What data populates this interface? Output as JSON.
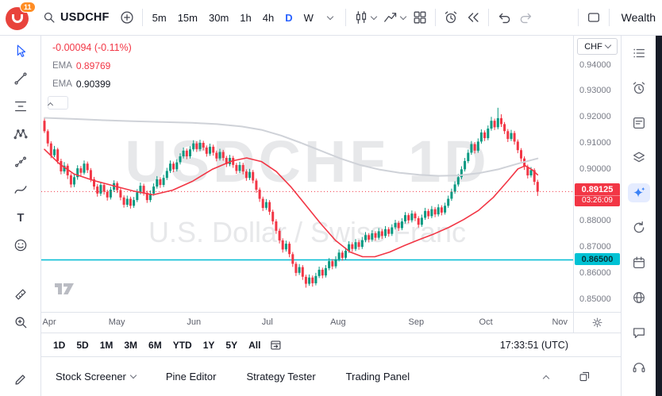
{
  "topbar": {
    "logo_badge": "11",
    "symbol": "USDCHF",
    "timeframes": [
      "5m",
      "15m",
      "30m",
      "1h",
      "4h",
      "D",
      "W"
    ],
    "active_timeframe": "D",
    "right_label": "Wealth"
  },
  "icons": {
    "text_tool_glyph": "T"
  },
  "legend": {
    "change": "-0.00094 (-0.11%)",
    "ema_fast_label": "EMA",
    "ema_fast_value": "0.89769",
    "ema_slow_label": "EMA",
    "ema_slow_value": "0.90399"
  },
  "watermark": {
    "title": "USDCHF 1D",
    "subtitle": "U.S. Dollar / Swiss Franc"
  },
  "price_axis": {
    "currency_label": "CHF",
    "tick_labels": [
      "0.94000",
      "0.93000",
      "0.92000",
      "0.91000",
      "0.90000",
      "0.88000",
      "0.87000",
      "0.86000",
      "0.85000"
    ],
    "last_price_badge": {
      "price": "0.89125",
      "countdown": "03:26:09"
    },
    "level_badge": "0.86500"
  },
  "range_toolbar": {
    "items": [
      "1D",
      "5D",
      "1M",
      "3M",
      "6M",
      "YTD",
      "1Y",
      "5Y",
      "All"
    ],
    "clock": "17:33:51 (UTC)"
  },
  "bottom_panel": {
    "tabs": [
      "Stock Screener",
      "Pine Editor",
      "Strategy Tester",
      "Trading Panel"
    ]
  },
  "chart_data": {
    "type": "candlestick",
    "symbol": "USDCHF",
    "interval": "1D",
    "ylim": [
      0.845,
      0.9512
    ],
    "levels": {
      "last": 0.89125,
      "support": 0.865
    },
    "colors": {
      "up": "#089981",
      "down": "#f23645",
      "ema_fast": "#f23645",
      "ema_slow": "#cfd2d8",
      "support": "#00bcd4"
    },
    "months": [
      {
        "label": "Apr",
        "frac": 0.015
      },
      {
        "label": "May",
        "frac": 0.142
      },
      {
        "label": "Jun",
        "frac": 0.287
      },
      {
        "label": "Jul",
        "frac": 0.425
      },
      {
        "label": "Aug",
        "frac": 0.558
      },
      {
        "label": "Sep",
        "frac": 0.705
      },
      {
        "label": "Oct",
        "frac": 0.836
      },
      {
        "label": "Nov",
        "frac": 0.975
      }
    ],
    "ema_slow_points": [
      [
        0,
        0.9196
      ],
      [
        0.06,
        0.9192
      ],
      [
        0.12,
        0.9187
      ],
      [
        0.18,
        0.9183
      ],
      [
        0.24,
        0.918
      ],
      [
        0.3,
        0.9177
      ],
      [
        0.35,
        0.9172
      ],
      [
        0.4,
        0.9163
      ],
      [
        0.44,
        0.915
      ],
      [
        0.48,
        0.9128
      ],
      [
        0.52,
        0.91
      ],
      [
        0.56,
        0.907
      ],
      [
        0.6,
        0.904
      ],
      [
        0.64,
        0.9015
      ],
      [
        0.68,
        0.8997
      ],
      [
        0.72,
        0.8985
      ],
      [
        0.76,
        0.8977
      ],
      [
        0.8,
        0.8973
      ],
      [
        0.84,
        0.8975
      ],
      [
        0.88,
        0.8983
      ],
      [
        0.92,
        0.8998
      ],
      [
        0.96,
        0.902
      ],
      [
        1,
        0.904
      ]
    ],
    "ema_fast_points": [
      [
        0,
        0.9075
      ],
      [
        0.03,
        0.902
      ],
      [
        0.06,
        0.898
      ],
      [
        0.1,
        0.8955
      ],
      [
        0.14,
        0.8935
      ],
      [
        0.18,
        0.8915
      ],
      [
        0.22,
        0.89
      ],
      [
        0.26,
        0.8918
      ],
      [
        0.3,
        0.8952
      ],
      [
        0.34,
        0.8998
      ],
      [
        0.38,
        0.903
      ],
      [
        0.41,
        0.9042
      ],
      [
        0.44,
        0.9028
      ],
      [
        0.47,
        0.899
      ],
      [
        0.5,
        0.893
      ],
      [
        0.53,
        0.886
      ],
      [
        0.56,
        0.879
      ],
      [
        0.59,
        0.8725
      ],
      [
        0.62,
        0.868
      ],
      [
        0.645,
        0.8662
      ],
      [
        0.67,
        0.8662
      ],
      [
        0.7,
        0.868
      ],
      [
        0.73,
        0.8705
      ],
      [
        0.76,
        0.8728
      ],
      [
        0.79,
        0.875
      ],
      [
        0.82,
        0.8775
      ],
      [
        0.85,
        0.8805
      ],
      [
        0.88,
        0.884
      ],
      [
        0.91,
        0.889
      ],
      [
        0.94,
        0.8955
      ],
      [
        0.96,
        0.9
      ],
      [
        0.975,
        0.9012
      ],
      [
        0.99,
        0.8995
      ],
      [
        1,
        0.8977
      ]
    ],
    "candles": [
      [
        0.9185,
        0.9193,
        0.9138,
        0.9145
      ],
      [
        0.9145,
        0.9152,
        0.9086,
        0.9098
      ],
      [
        0.9098,
        0.9106,
        0.9041,
        0.9052
      ],
      [
        0.9052,
        0.9088,
        0.9045,
        0.9075
      ],
      [
        0.9075,
        0.9081,
        0.9019,
        0.903
      ],
      [
        0.903,
        0.9039,
        0.8979,
        0.899
      ],
      [
        0.899,
        0.9026,
        0.8982,
        0.9012
      ],
      [
        0.9012,
        0.902,
        0.8961,
        0.8975
      ],
      [
        0.8975,
        0.8983,
        0.8928,
        0.894
      ],
      [
        0.894,
        0.8979,
        0.893,
        0.8968
      ],
      [
        0.8968,
        0.9014,
        0.8958,
        0.9002
      ],
      [
        0.9002,
        0.9011,
        0.8972,
        0.8985
      ],
      [
        0.8985,
        0.9032,
        0.8978,
        0.902
      ],
      [
        0.902,
        0.9028,
        0.8984,
        0.8995
      ],
      [
        0.8995,
        0.9003,
        0.8949,
        0.896
      ],
      [
        0.896,
        0.8969,
        0.892,
        0.8932
      ],
      [
        0.8932,
        0.8941,
        0.8893,
        0.8905
      ],
      [
        0.8905,
        0.895,
        0.8896,
        0.8938
      ],
      [
        0.8938,
        0.8946,
        0.8901,
        0.8912
      ],
      [
        0.8912,
        0.892,
        0.8878,
        0.889
      ],
      [
        0.889,
        0.8931,
        0.8882,
        0.892
      ],
      [
        0.892,
        0.8956,
        0.8911,
        0.8945
      ],
      [
        0.8945,
        0.8952,
        0.8907,
        0.8918
      ],
      [
        0.8918,
        0.8926,
        0.8879,
        0.889
      ],
      [
        0.889,
        0.8898,
        0.8851,
        0.8862
      ],
      [
        0.8862,
        0.8897,
        0.8853,
        0.8885
      ],
      [
        0.8885,
        0.8893,
        0.8847,
        0.8858
      ],
      [
        0.8858,
        0.8892,
        0.885,
        0.888
      ],
      [
        0.888,
        0.8922,
        0.8872,
        0.891
      ],
      [
        0.891,
        0.8947,
        0.8902,
        0.8935
      ],
      [
        0.8935,
        0.8943,
        0.8897,
        0.8908
      ],
      [
        0.8908,
        0.8916,
        0.8869,
        0.888
      ],
      [
        0.888,
        0.8917,
        0.8872,
        0.8905
      ],
      [
        0.8905,
        0.8944,
        0.8897,
        0.8932
      ],
      [
        0.8932,
        0.8972,
        0.8924,
        0.896
      ],
      [
        0.896,
        0.8968,
        0.8927,
        0.8938
      ],
      [
        0.8938,
        0.8977,
        0.893,
        0.8965
      ],
      [
        0.8965,
        0.9004,
        0.8957,
        0.8992
      ],
      [
        0.8992,
        0.9032,
        0.8984,
        0.902
      ],
      [
        0.902,
        0.9028,
        0.8987,
        0.8998
      ],
      [
        0.8998,
        0.9037,
        0.899,
        0.9025
      ],
      [
        0.9025,
        0.906,
        0.9017,
        0.9048
      ],
      [
        0.9048,
        0.9082,
        0.904,
        0.907
      ],
      [
        0.907,
        0.9078,
        0.9037,
        0.9048
      ],
      [
        0.9048,
        0.9087,
        0.904,
        0.9075
      ],
      [
        0.9075,
        0.911,
        0.9067,
        0.9098
      ],
      [
        0.9098,
        0.9106,
        0.9065,
        0.9076
      ],
      [
        0.9076,
        0.9112,
        0.9068,
        0.91
      ],
      [
        0.91,
        0.9108,
        0.9071,
        0.9082
      ],
      [
        0.9082,
        0.909,
        0.9047,
        0.9058
      ],
      [
        0.9058,
        0.9097,
        0.905,
        0.9085
      ],
      [
        0.9085,
        0.9093,
        0.9051,
        0.9062
      ],
      [
        0.9062,
        0.907,
        0.9029,
        0.904
      ],
      [
        0.904,
        0.9077,
        0.9032,
        0.9065
      ],
      [
        0.9065,
        0.9073,
        0.9031,
        0.9042
      ],
      [
        0.9042,
        0.905,
        0.9007,
        0.9018
      ],
      [
        0.9018,
        0.9054,
        0.901,
        0.9042
      ],
      [
        0.9042,
        0.905,
        0.9004,
        0.9015
      ],
      [
        0.9015,
        0.9023,
        0.8981,
        0.8992
      ],
      [
        0.8992,
        0.9027,
        0.8984,
        0.9015
      ],
      [
        0.9015,
        0.9023,
        0.8979,
        0.899
      ],
      [
        0.899,
        0.8998,
        0.8954,
        0.8965
      ],
      [
        0.8965,
        0.9,
        0.8957,
        0.8988
      ],
      [
        0.8988,
        0.8996,
        0.8944,
        0.8955
      ],
      [
        0.8955,
        0.8963,
        0.8908,
        0.892
      ],
      [
        0.892,
        0.8928,
        0.8873,
        0.8885
      ],
      [
        0.8885,
        0.8893,
        0.8838,
        0.885
      ],
      [
        0.885,
        0.8884,
        0.8842,
        0.8872
      ],
      [
        0.8872,
        0.888,
        0.8823,
        0.8835
      ],
      [
        0.8835,
        0.8843,
        0.8786,
        0.8798
      ],
      [
        0.8798,
        0.8806,
        0.875,
        0.8762
      ],
      [
        0.8762,
        0.877,
        0.8713,
        0.8725
      ],
      [
        0.8725,
        0.8733,
        0.8678,
        0.869
      ],
      [
        0.869,
        0.8724,
        0.8682,
        0.8712
      ],
      [
        0.8712,
        0.872,
        0.866,
        0.8672
      ],
      [
        0.8672,
        0.868,
        0.8623,
        0.8635
      ],
      [
        0.8635,
        0.8643,
        0.8588,
        0.86
      ],
      [
        0.86,
        0.8634,
        0.8592,
        0.8622
      ],
      [
        0.8622,
        0.863,
        0.8573,
        0.8585
      ],
      [
        0.8585,
        0.8593,
        0.8543,
        0.8558
      ],
      [
        0.8558,
        0.8594,
        0.855,
        0.8582
      ],
      [
        0.8582,
        0.859,
        0.8547,
        0.856
      ],
      [
        0.856,
        0.86,
        0.8552,
        0.8588
      ],
      [
        0.8588,
        0.8624,
        0.858,
        0.8612
      ],
      [
        0.8612,
        0.862,
        0.8579,
        0.859
      ],
      [
        0.859,
        0.863,
        0.8582,
        0.8618
      ],
      [
        0.8618,
        0.8657,
        0.861,
        0.8645
      ],
      [
        0.8645,
        0.8653,
        0.8614,
        0.8625
      ],
      [
        0.8625,
        0.8664,
        0.8617,
        0.8652
      ],
      [
        0.8652,
        0.869,
        0.8644,
        0.8678
      ],
      [
        0.8678,
        0.8686,
        0.8647,
        0.8658
      ],
      [
        0.8658,
        0.8697,
        0.865,
        0.8685
      ],
      [
        0.8685,
        0.8722,
        0.8677,
        0.871
      ],
      [
        0.871,
        0.8718,
        0.8681,
        0.8692
      ],
      [
        0.8692,
        0.873,
        0.8684,
        0.8718
      ],
      [
        0.8718,
        0.8726,
        0.8689,
        0.87
      ],
      [
        0.87,
        0.8738,
        0.8692,
        0.8726
      ],
      [
        0.8726,
        0.8757,
        0.8718,
        0.8745
      ],
      [
        0.8745,
        0.8753,
        0.8717,
        0.8728
      ],
      [
        0.8728,
        0.8764,
        0.872,
        0.8752
      ],
      [
        0.8752,
        0.876,
        0.8724,
        0.8735
      ],
      [
        0.8735,
        0.8772,
        0.8727,
        0.876
      ],
      [
        0.876,
        0.8768,
        0.8731,
        0.8742
      ],
      [
        0.8742,
        0.878,
        0.8734,
        0.8768
      ],
      [
        0.8768,
        0.8776,
        0.8739,
        0.875
      ],
      [
        0.875,
        0.8787,
        0.8742,
        0.8775
      ],
      [
        0.8775,
        0.8804,
        0.8767,
        0.8792
      ],
      [
        0.8792,
        0.88,
        0.8761,
        0.8772
      ],
      [
        0.8772,
        0.881,
        0.8764,
        0.8798
      ],
      [
        0.8798,
        0.8834,
        0.879,
        0.8822
      ],
      [
        0.8822,
        0.883,
        0.8791,
        0.8802
      ],
      [
        0.8802,
        0.884,
        0.8794,
        0.8828
      ],
      [
        0.8828,
        0.8836,
        0.8799,
        0.881
      ],
      [
        0.881,
        0.8818,
        0.8774,
        0.8785
      ],
      [
        0.8785,
        0.8824,
        0.8777,
        0.8812
      ],
      [
        0.8812,
        0.885,
        0.8804,
        0.8838
      ],
      [
        0.8838,
        0.8846,
        0.8807,
        0.8818
      ],
      [
        0.8818,
        0.8857,
        0.881,
        0.8845
      ],
      [
        0.8845,
        0.8853,
        0.8814,
        0.8825
      ],
      [
        0.8825,
        0.8864,
        0.8817,
        0.8852
      ],
      [
        0.8852,
        0.886,
        0.8821,
        0.8832
      ],
      [
        0.8832,
        0.887,
        0.8824,
        0.8858
      ],
      [
        0.8858,
        0.8897,
        0.885,
        0.8885
      ],
      [
        0.8885,
        0.8924,
        0.8877,
        0.8912
      ],
      [
        0.8912,
        0.8952,
        0.8904,
        0.894
      ],
      [
        0.894,
        0.898,
        0.8932,
        0.8968
      ],
      [
        0.8968,
        0.901,
        0.896,
        0.8998
      ],
      [
        0.8998,
        0.9042,
        0.899,
        0.903
      ],
      [
        0.903,
        0.9074,
        0.9022,
        0.9062
      ],
      [
        0.9062,
        0.9107,
        0.9054,
        0.9095
      ],
      [
        0.9095,
        0.9103,
        0.9059,
        0.907
      ],
      [
        0.907,
        0.9117,
        0.9062,
        0.9105
      ],
      [
        0.9105,
        0.9152,
        0.9097,
        0.914
      ],
      [
        0.914,
        0.9148,
        0.9107,
        0.9118
      ],
      [
        0.9118,
        0.9167,
        0.911,
        0.9155
      ],
      [
        0.9155,
        0.92,
        0.9147,
        0.9185
      ],
      [
        0.9185,
        0.9193,
        0.9149,
        0.916
      ],
      [
        0.916,
        0.9235,
        0.9152,
        0.9195
      ],
      [
        0.9195,
        0.921,
        0.9161,
        0.9172
      ],
      [
        0.9172,
        0.918,
        0.9134,
        0.9145
      ],
      [
        0.9145,
        0.9153,
        0.9103,
        0.9115
      ],
      [
        0.9115,
        0.915,
        0.9107,
        0.9138
      ],
      [
        0.9138,
        0.9146,
        0.9093,
        0.9105
      ],
      [
        0.9105,
        0.9113,
        0.906,
        0.9072
      ],
      [
        0.9072,
        0.908,
        0.9028,
        0.904
      ],
      [
        0.904,
        0.9048,
        0.8996,
        0.9008
      ],
      [
        0.9008,
        0.9016,
        0.8963,
        0.8975
      ],
      [
        0.8975,
        0.9007,
        0.8967,
        0.8995
      ],
      [
        0.8995,
        0.9002,
        0.8938,
        0.895
      ],
      [
        0.895,
        0.8958,
        0.8896,
        0.89125
      ]
    ]
  }
}
